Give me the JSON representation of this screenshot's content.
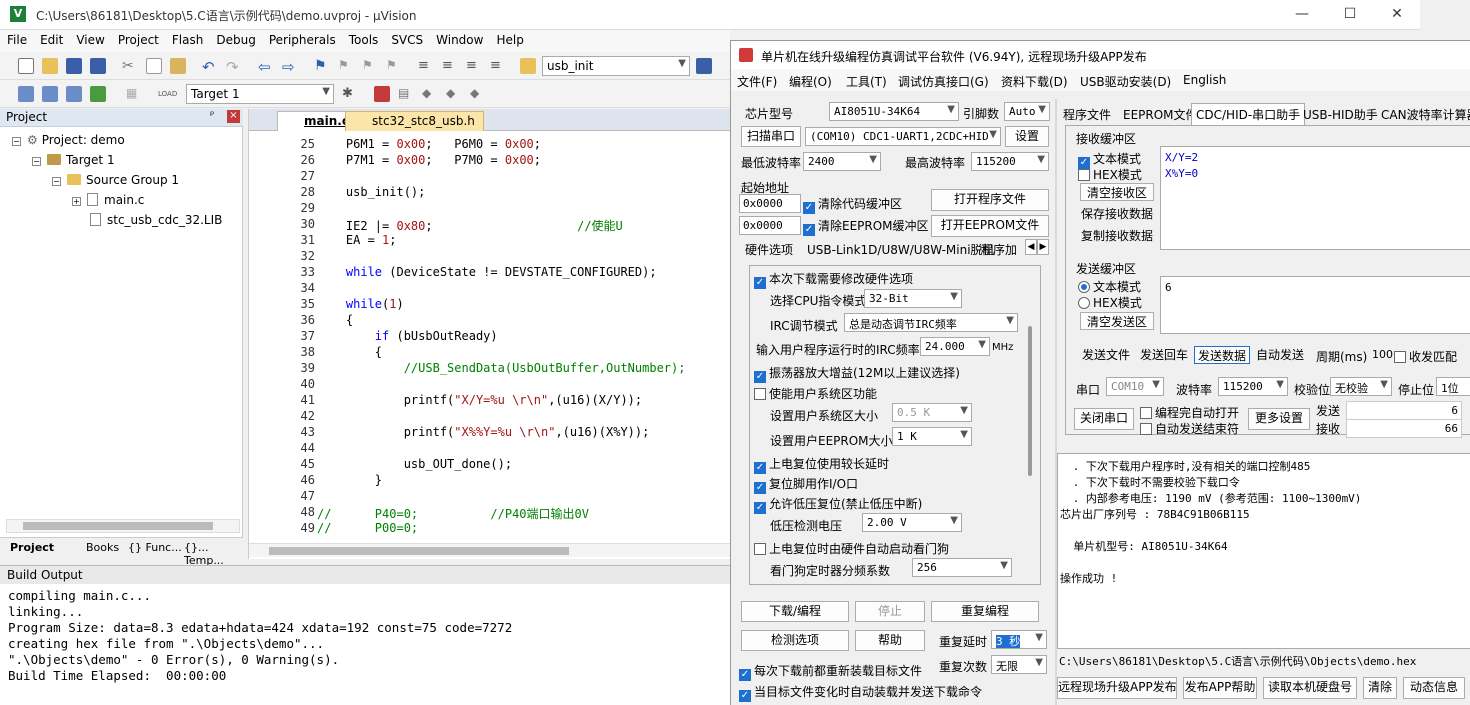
{
  "kv": {
    "title": "C:\\Users\\86181\\Desktop\\5.C语言\\示例代码\\demo.uvproj - µVision",
    "logo_letter": "V",
    "menu": [
      "File",
      "Edit",
      "View",
      "Project",
      "Flash",
      "Debug",
      "Peripherals",
      "Tools",
      "SVCS",
      "Window",
      "Help"
    ],
    "toolbar_combo": "usb_init",
    "target_combo": "Target 1",
    "project": {
      "header": "Project",
      "pin": "ᵖ",
      "close": "×",
      "root": "Project: demo",
      "target": "Target 1",
      "group": "Source Group 1",
      "files": [
        "main.c",
        "stc_usb_cdc_32.LIB"
      ],
      "tabs": [
        "Project",
        "Books",
        "{} Func...",
        "{}... Temp..."
      ]
    },
    "editor": {
      "tabs": [
        "main.c",
        "stc32_stc8_usb.h"
      ],
      "lines": [
        {
          "n": "25",
          "t": "    P6M1 = 0x00;   P6M0 = 0x00;"
        },
        {
          "n": "26",
          "t": "    P7M1 = 0x00;   P7M0 = 0x00;"
        },
        {
          "n": "27",
          "t": ""
        },
        {
          "n": "28",
          "t": "    usb_init();"
        },
        {
          "n": "29",
          "t": ""
        },
        {
          "n": "30",
          "t": "    IE2 |= 0x80;                    //使能U"
        },
        {
          "n": "31",
          "t": "    EA = 1;"
        },
        {
          "n": "32",
          "t": ""
        },
        {
          "n": "33",
          "t": "    while (DeviceState != DEVSTATE_CONFIGURED);"
        },
        {
          "n": "34",
          "t": ""
        },
        {
          "n": "35",
          "t": "    while(1)"
        },
        {
          "n": "36",
          "t": "    {"
        },
        {
          "n": "37",
          "t": "        if (bUsbOutReady)"
        },
        {
          "n": "38",
          "t": "        {"
        },
        {
          "n": "39",
          "t": "            //USB_SendData(UsbOutBuffer,OutNumber);"
        },
        {
          "n": "40",
          "t": ""
        },
        {
          "n": "41",
          "t": "            printf(\"X/Y=%u \\r\\n\",(u16)(X/Y));"
        },
        {
          "n": "42",
          "t": ""
        },
        {
          "n": "43",
          "t": "            printf(\"X%%Y=%u \\r\\n\",(u16)(X%Y));"
        },
        {
          "n": "44",
          "t": ""
        },
        {
          "n": "45",
          "t": "            usb_OUT_done();"
        },
        {
          "n": "46",
          "t": "        }"
        },
        {
          "n": "47",
          "t": ""
        },
        {
          "n": "48",
          "t": "//      P40=0;          //P40端口输出0V"
        },
        {
          "n": "49",
          "t": "//      P00=0;"
        }
      ]
    },
    "build": {
      "header": "Build Output",
      "lines": [
        "compiling main.c...",
        "linking...",
        "Program Size: data=8.3 edata+hdata=424 xdata=192 const=75 code=7272",
        "creating hex file from \".\\Objects\\demo\"...",
        "\".\\Objects\\demo\" - 0 Error(s), 0 Warning(s).",
        "Build Time Elapsed:  00:00:00"
      ]
    }
  },
  "isp": {
    "title": "单片机在线升级编程仿真调试平台软件 (V6.94Y), 远程现场升级APP发布",
    "menu": [
      "文件(F)",
      "编程(O)",
      "工具(T)",
      "调试仿真接口(G)",
      "资料下载(D)",
      "USB驱动安装(D)",
      "English"
    ],
    "chip_label": "芯片型号",
    "chip": "AI8051U-34K64",
    "pins_label": "引脚数",
    "pins": "Auto",
    "scan_btn": "扫描串口",
    "port": "(COM10) CDC1-UART1,2CDC+HID",
    "settings_btn": "设置",
    "min_baud_label": "最低波特率",
    "min_baud": "2400",
    "max_baud_label": "最高波特率",
    "max_baud": "115200",
    "start_addr_label": "起始地址",
    "addr1": "0x0000",
    "clear_code": "清除代码缓冲区",
    "open_prog": "打开程序文件",
    "addr2": "0x0000",
    "clear_eeprom": "清除EEPROM缓冲区",
    "open_eeprom": "打开EEPROM文件",
    "hw_tabs": [
      "硬件选项",
      "USB-Link1D/U8W/U8W-Mini脱机",
      "程序加"
    ],
    "hw": {
      "opt1": "本次下载需要修改硬件选项",
      "cpu_mode_label": "选择CPU指令模式",
      "cpu_mode": "32-Bit",
      "irc_mode_label": "IRC调节模式",
      "irc_mode": "总是动态调节IRC频率",
      "irc_freq_label": "输入用户程序运行时的IRC频率",
      "irc_freq": "24.000",
      "mhz": "MHz",
      "opt_osc": "振荡器放大增益(12M以上建议选择)",
      "opt_sys": "使能用户系统区功能",
      "sys_size_label": "设置用户系统区大小",
      "sys_size": "0.5 K",
      "eeprom_size_label": "设置用户EEPROM大小",
      "eeprom_size": "1   K",
      "opt_delay": "上电复位使用较长延时",
      "opt_io": "复位脚用作I/O口",
      "opt_lvr": "允许低压复位(禁止低压中断)",
      "lvr_label": "低压检测电压",
      "lvr": "2.00 V",
      "opt_wdt": "上电复位时由硬件自动启动看门狗",
      "wdt_label": "看门狗定时器分频系数",
      "wdt": "256"
    },
    "download_btn": "下载/编程",
    "stop_btn": "停止",
    "reprog_btn": "重复编程",
    "check_btn": "检测选项",
    "help_btn": "帮助",
    "delay_label": "重复延时",
    "delay": "3 秒",
    "reload_opt": "每次下载前都重新装载目标文件",
    "count_label": "重复次数",
    "count": "无限",
    "auto_opt": "当目标文件变化时自动装载并发送下载命令",
    "right_tabs": [
      "程序文件",
      "EEPROM文件",
      "CDC/HID-串口助手",
      "USB-HID助手",
      "CAN波特率计算器"
    ],
    "recv_label": "接收缓冲区",
    "text_mode": "文本模式",
    "hex_mode": "HEX模式",
    "clear_recv": "清空接收区",
    "save_recv": "保存接收数据",
    "copy_recv": "复制接收数据",
    "recv_lines": [
      "X/Y=2",
      "X%Y=0"
    ],
    "send_label": "发送缓冲区",
    "clear_send": "清空发送区",
    "send_text": "6",
    "send_file": "发送文件",
    "send_cr": "发送回车",
    "send_data": "发送数据",
    "auto_send": "自动发送",
    "period_label": "周期(ms)",
    "period": "100",
    "match_label": "收发匹配",
    "serial_label": "串口",
    "serial": "COM10",
    "baud_label": "波特率",
    "baud": "115200",
    "parity_label": "校验位",
    "parity": "无校验",
    "stop_label": "停止位",
    "stopbits": "1位",
    "close_port": "关闭串口",
    "open_after": "编程完自动打开",
    "auto_end": "自动发送结束符",
    "more_btn": "更多设置",
    "sent_label": "发送",
    "sent": "6",
    "recv_count_label": "接收",
    "recv_count": "66",
    "log": [
      " . 下次下载用户程序时,没有相关的端口控制485",
      " . 下次下载时不需要校验下载口令",
      " . 内部参考电压: 1190 mV (参考范围: 1100~1300mV)",
      "芯片出厂序列号 : 78B4C91B06B115",
      "",
      "  单片机型号: AI8051U-34K64",
      "",
      "操作成功 !"
    ],
    "hex_path": "C:\\Users\\86181\\Desktop\\5.C语言\\示例代码\\Objects\\demo.hex",
    "bottom_btns": [
      "远程现场升级APP发布",
      "发布APP帮助",
      "读取本机硬盘号",
      "清除",
      "动态信息"
    ]
  }
}
